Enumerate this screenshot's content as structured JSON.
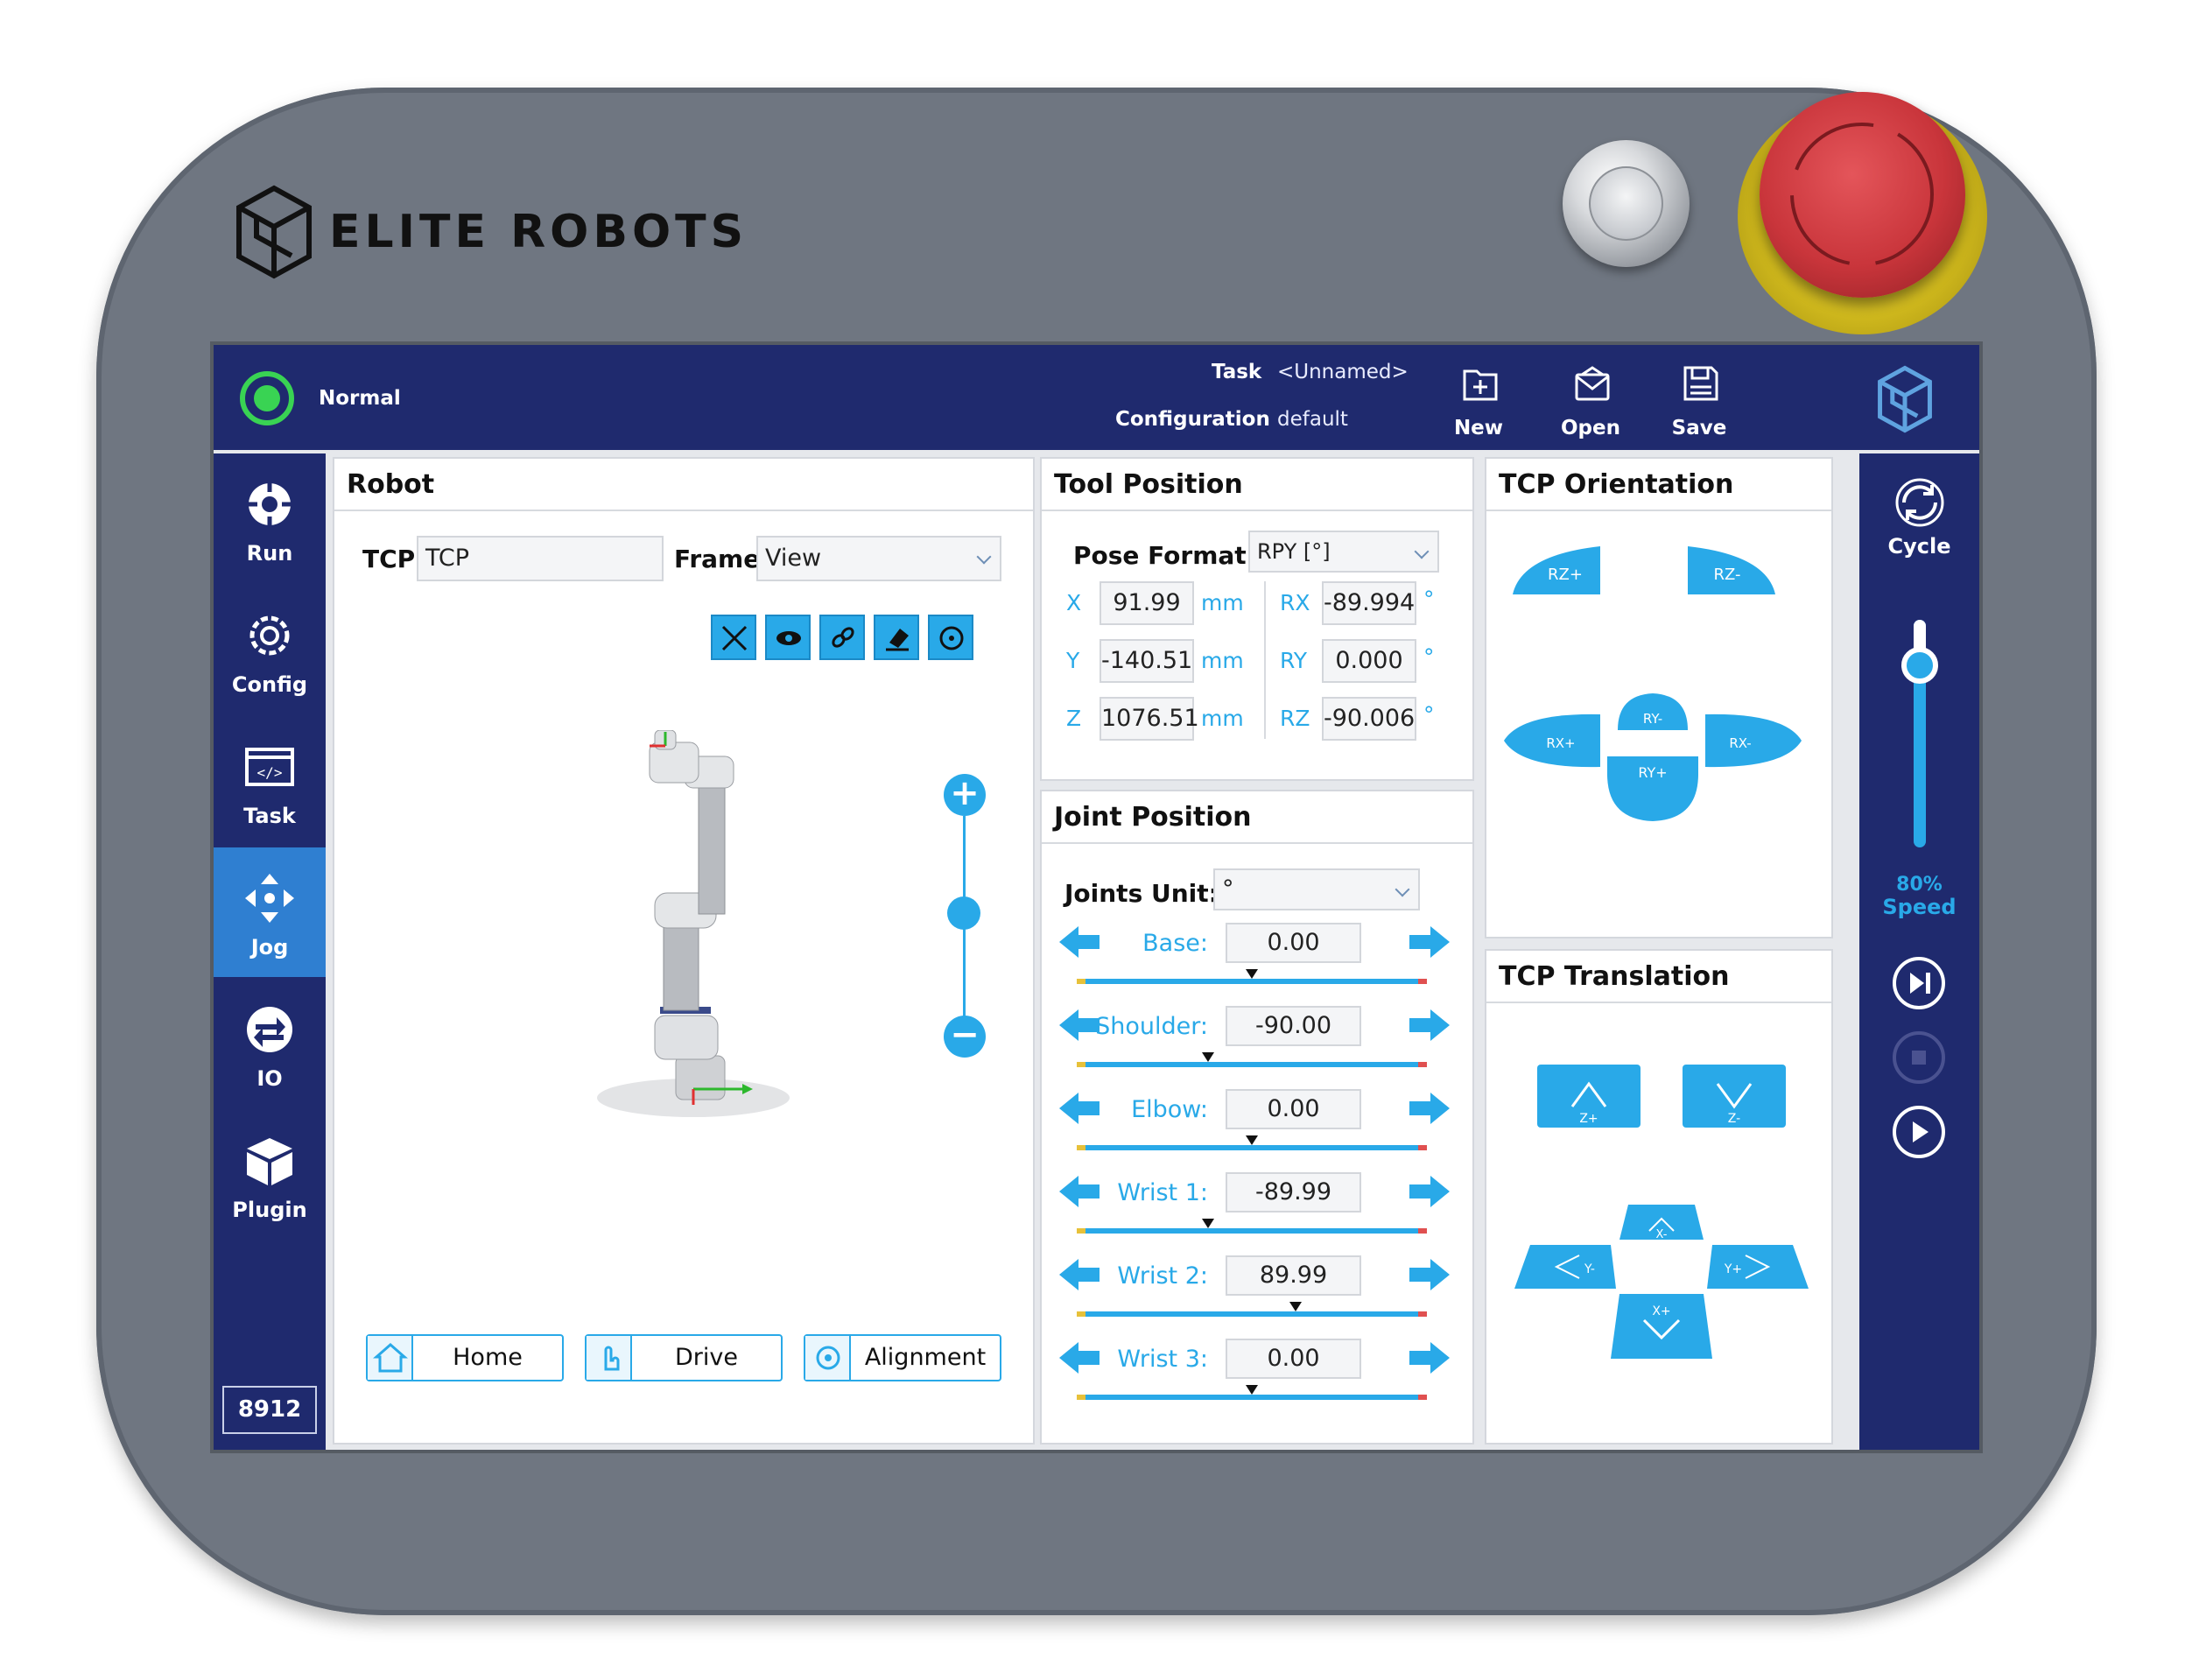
{
  "device": {
    "brand": "ELITE ROBOTS"
  },
  "topbar": {
    "status": "Normal",
    "task_label": "Task",
    "task_value": "<Unnamed>",
    "config_label": "Configuration",
    "config_value": "default",
    "new_label": "New",
    "open_label": "Open",
    "save_label": "Save"
  },
  "sidebar": {
    "items": [
      {
        "label": "Run"
      },
      {
        "label": "Config"
      },
      {
        "label": "Task"
      },
      {
        "label": "Jog"
      },
      {
        "label": "IO"
      },
      {
        "label": "Plugin"
      }
    ],
    "active": "Jog",
    "badge": "8912"
  },
  "right_sidebar": {
    "cycle_label": "Cycle",
    "speed_value": "80%",
    "speed_label": "Speed",
    "speed_fraction": 0.8
  },
  "robot_panel": {
    "title": "Robot",
    "tcp_label": "TCP",
    "tcp_value": "TCP",
    "frame_label": "Frame",
    "frame_value": "View",
    "home_label": "Home",
    "drive_label": "Drive",
    "alignment_label": "Alignment"
  },
  "tool_position": {
    "title": "Tool Position",
    "pose_format_label": "Pose Format:",
    "pose_format_value": "RPY [°]",
    "x_label": "X",
    "x_value": "91.99",
    "x_unit": "mm",
    "y_label": "Y",
    "y_value": "-140.51",
    "y_unit": "mm",
    "z_label": "Z",
    "z_value": "1076.51",
    "z_unit": "mm",
    "rx_label": "RX",
    "rx_value": "-89.994",
    "rx_unit": "°",
    "ry_label": "RY",
    "ry_value": "0.000",
    "ry_unit": "°",
    "rz_label": "RZ",
    "rz_value": "-90.006",
    "rz_unit": "°"
  },
  "joint_position": {
    "title": "Joint Position",
    "unit_label": "Joints Unit:",
    "unit_value": "°",
    "joints": [
      {
        "label": "Base:",
        "value": "0.00",
        "fraction": 0.5
      },
      {
        "label": "Shoulder:",
        "value": "-90.00",
        "fraction": 0.375
      },
      {
        "label": "Elbow:",
        "value": "0.00",
        "fraction": 0.5
      },
      {
        "label": "Wrist 1:",
        "value": "-89.99",
        "fraction": 0.375
      },
      {
        "label": "Wrist 2:",
        "value": "89.99",
        "fraction": 0.625
      },
      {
        "label": "Wrist 3:",
        "value": "0.00",
        "fraction": 0.5
      }
    ]
  },
  "tcp_orientation": {
    "title": "TCP Orientation",
    "rz_plus": "RZ+",
    "rz_minus": "RZ-",
    "rx_plus": "RX+",
    "rx_minus": "RX-",
    "ry_plus": "RY+",
    "ry_minus": "RY-"
  },
  "tcp_translation": {
    "title": "TCP Translation",
    "z_plus": "Z+",
    "z_minus": "Z-",
    "x_plus": "X+",
    "x_minus": "X-",
    "y_plus": "Y+",
    "y_minus": "Y-"
  },
  "colors": {
    "accent": "#29a9e8",
    "nav": "#1f2a6e",
    "status_ok": "#39d353",
    "estop": "#c9353b"
  }
}
